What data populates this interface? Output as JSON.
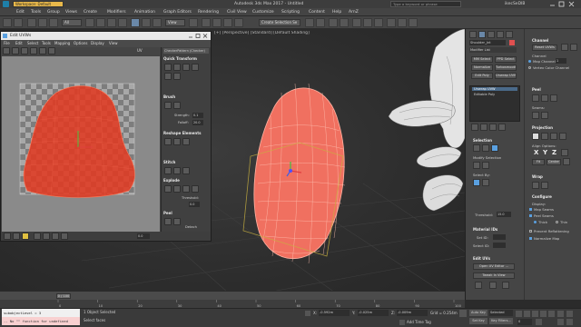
{
  "app": {
    "title": "Autodesk 3ds Max 2017 - Untitled",
    "workspace": "Workspace: Default",
    "search_placeholder": "Type a keyword or phrase",
    "user": "ikecSeDIB"
  },
  "menu": [
    "Edit",
    "Tools",
    "Group",
    "Views",
    "Create",
    "Modifiers",
    "Animation",
    "Graph Editors",
    "Rendering",
    "Civil View",
    "Customize",
    "Scripting",
    "Content",
    "Help",
    "ArnZ"
  ],
  "toolbar": {
    "selection_filter": "All",
    "view": "View",
    "named_set": "Create Selection Se"
  },
  "viewport": {
    "label": "[+] [Perspective] [Standard] [Default Shading]"
  },
  "uvw_editor": {
    "title": "Edit UVWs",
    "menu": [
      "File",
      "Edit",
      "Select",
      "Tools",
      "Mapping",
      "Options",
      "Display",
      "View"
    ],
    "uv_mode": "UV",
    "texture": "CheckerPattern (Checker)",
    "sections": {
      "quick_transform": "Quick Transform",
      "brush": "Brush",
      "reshape": "Reshape Elements",
      "stitch": "Stitch",
      "explode": "Explode",
      "peel": "Peel"
    },
    "strength_label": "Strength:",
    "strength_value": "0.1",
    "falloff_label": "Falloff:",
    "falloff_value": "20.0",
    "threshold_label": "Threshold:",
    "threshold_value": "0.0",
    "detach_label": "Detach",
    "bottom_value": "0.0"
  },
  "command_panel": {
    "object_name": "Shoulder_Jnt",
    "modifier_list": "Modifier List",
    "buttons": [
      "MM Select",
      "PPD Select",
      "Normalize",
      "Turbosmooth",
      "Edit Poly",
      "Unwrap UVW"
    ],
    "stack": [
      "Unwrap UVW",
      "Editable Poly"
    ],
    "selection_title": "Selection",
    "modify_selection": "Modify Selection",
    "select_by": "Select By:",
    "threshold_label": "Threshold:",
    "threshold_value": "15.0",
    "material_ids_title": "Material IDs",
    "set_id_label": "Set ID:",
    "select_id_label": "Select ID:",
    "edit_uvs_title": "Edit UVs",
    "open_uv_editor": "Open UV Editor ...",
    "tweak_in_view": "Tweak In View",
    "channel_title": "Channel",
    "reset_uvws": "Reset UVWs",
    "map_channel_label": "Map Channel:",
    "map_channel_value": "1",
    "vertex_color_channel": "Vertex Color Channel",
    "peel_title": "Peel",
    "seams_label": "Seams:",
    "projection_title": "Projection",
    "align_options": "Align Options:",
    "xyz": [
      "X",
      "Y",
      "Z"
    ],
    "fit": "Fit",
    "center": "Center",
    "wrap_title": "Wrap",
    "configure_title": "Configure",
    "display_label": "Display:",
    "map_seams": "Map Seams",
    "peel_seams": "Peel Seams",
    "thick": "Thick",
    "thin": "Thin",
    "prevent_reflattening": "Prevent Reflattening",
    "normalize_map": "Normalize Map"
  },
  "timeline": {
    "frame": "0 / 100",
    "ticks": [
      "0",
      "10",
      "20",
      "30",
      "40",
      "50",
      "60",
      "70",
      "80",
      "90",
      "100"
    ]
  },
  "status": {
    "script_line1": "modPanel.addModToSelection (Unwr",
    "script_line2": "subobjectLevel = 3",
    "script_line3": "-- No \"\" function for undefined",
    "objects_selected": "1 Object Selected",
    "hint": "Select faces",
    "x_label": "X:",
    "x_value": "-0.592m",
    "y_label": "Y:",
    "y_value": "-0.025m",
    "z_label": "Z:",
    "z_value": "-0.009m",
    "grid": "Grid = 0.254m",
    "add_time_tag": "Add Time Tag",
    "auto_key": "Auto Key",
    "set_key": "Set Key",
    "selected": "Selected",
    "key_filters": "Key Filters...",
    "frame_value": "0"
  },
  "colors": {
    "accent": "#5aa0e0",
    "mesh_fill": "#f07060",
    "mesh_line": "#ffb0a0",
    "uv_fill": "#e03a22",
    "gizmo": "#c8b040"
  }
}
